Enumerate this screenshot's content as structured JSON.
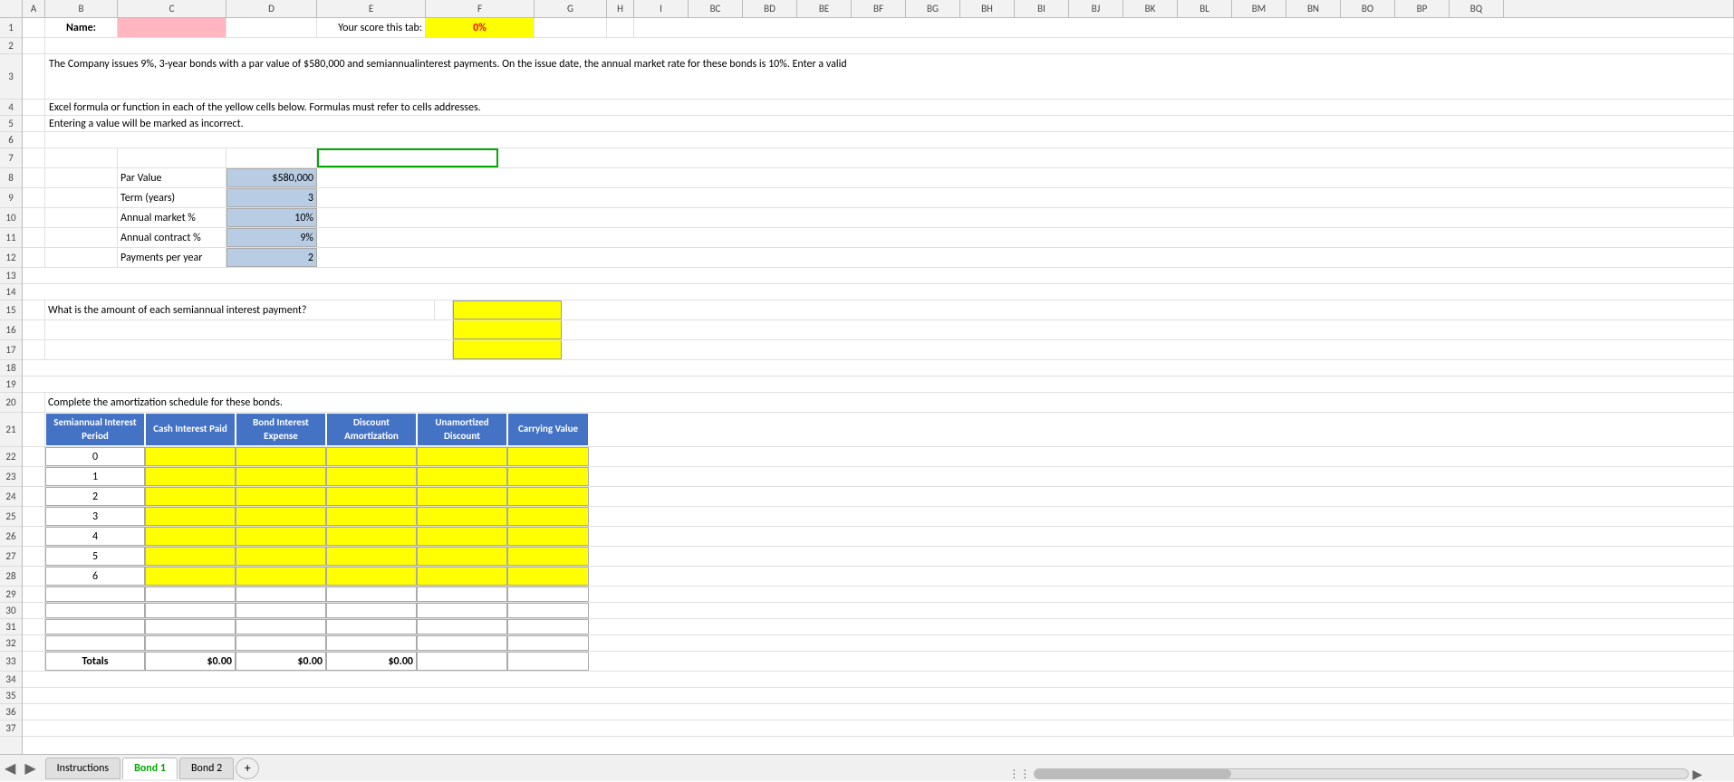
{
  "header": {
    "name_label": "Name:",
    "name_value": "",
    "score_label": "Your score this tab:",
    "score_value": "0%"
  },
  "description": {
    "line1": "The                    Company issues 9%, 3-year bonds with a par value of $580,000 and semiannual",
    "line2": "interest payments.  On the issue date, the annual market rate for these bonds is 10%.  Enter a valid",
    "line3": "Excel formula or function in each of the yellow cells below.  Formulas must refer to cells addresses.",
    "line4": "Entering a value will be marked as incorrect."
  },
  "bond_data": {
    "par_value_label": "Par Value",
    "par_value": "$580,000",
    "term_label": "Term (years)",
    "term_value": "3",
    "annual_market_label": "Annual market %",
    "annual_market_value": "10%",
    "annual_contract_label": "Annual contract %",
    "annual_contract_value": "9%",
    "payments_label": "Payments per year",
    "payments_value": "2"
  },
  "question1": {
    "text": "What is the amount of each semiannual interest payment?"
  },
  "table": {
    "title": "Complete the amortization schedule for these bonds.",
    "headers": [
      "Semiannual Interest Period",
      "Cash Interest Paid",
      "Bond Interest Expense",
      "Discount Amortization",
      "Unamortized Discount",
      "Carrying Value"
    ],
    "rows": [
      {
        "period": "0",
        "cash": "",
        "bond": "",
        "discount": "",
        "unamortized": "",
        "carrying": ""
      },
      {
        "period": "1",
        "cash": "",
        "bond": "",
        "discount": "",
        "unamortized": "",
        "carrying": ""
      },
      {
        "period": "2",
        "cash": "",
        "bond": "",
        "discount": "",
        "unamortized": "",
        "carrying": ""
      },
      {
        "period": "3",
        "cash": "",
        "bond": "",
        "discount": "",
        "unamortized": "",
        "carrying": ""
      },
      {
        "period": "4",
        "cash": "",
        "bond": "",
        "discount": "",
        "unamortized": "",
        "carrying": ""
      },
      {
        "period": "5",
        "cash": "",
        "bond": "",
        "discount": "",
        "unamortized": "",
        "carrying": ""
      },
      {
        "period": "6",
        "cash": "",
        "bond": "",
        "discount": "",
        "unamortized": "",
        "carrying": ""
      },
      {
        "period": "",
        "cash": "",
        "bond": "",
        "discount": "",
        "unamortized": "",
        "carrying": ""
      },
      {
        "period": "",
        "cash": "",
        "bond": "",
        "discount": "",
        "unamortized": "",
        "carrying": ""
      },
      {
        "period": "",
        "cash": "",
        "bond": "",
        "discount": "",
        "unamortized": "",
        "carrying": ""
      }
    ],
    "totals": {
      "label": "Totals",
      "cash": "$0.00",
      "bond": "$0.00",
      "discount": "$0.00"
    }
  },
  "tabs": {
    "instructions": "Instructions",
    "bond1": "Bond 1",
    "bond2": "Bond 2",
    "add": "+"
  },
  "columns": [
    "A",
    "B",
    "C",
    "D",
    "E",
    "F",
    "G",
    "H",
    "I",
    "BC",
    "BD",
    "BE",
    "BF",
    "BG",
    "BH",
    "BI",
    "BJ",
    "BK",
    "BL",
    "BM",
    "BN",
    "BO",
    "BP",
    "BQ"
  ]
}
